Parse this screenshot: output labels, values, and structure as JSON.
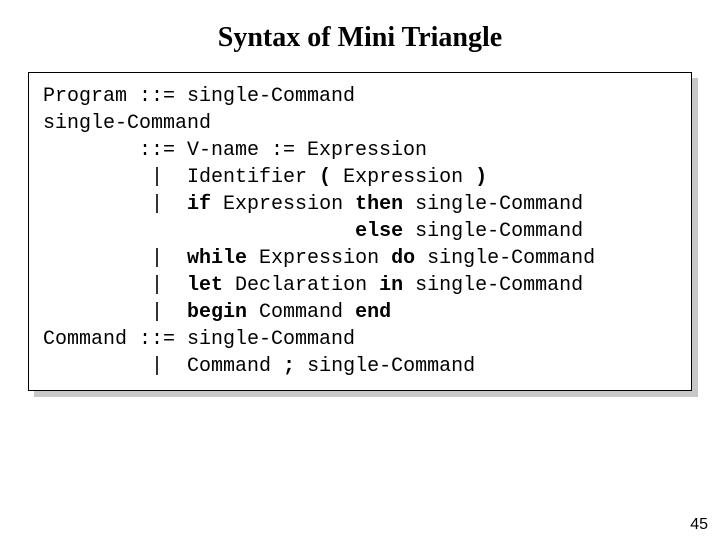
{
  "title": "Syntax of Mini Triangle",
  "page_number": "45",
  "grammar": {
    "l1a": "Program ::= single-Command",
    "l2a": "single-Command",
    "l3a": "        ::= V-name := Expression",
    "l4a": "         |  Identifier ",
    "l4b": "(",
    "l4c": " Expression ",
    "l4d": ")",
    "l5a": "         |  ",
    "l5b": "if",
    "l5c": " Expression ",
    "l5d": "then",
    "l5e": " single-Command",
    "l6a": "                          ",
    "l6b": "else",
    "l6c": " single-Command",
    "l7a": "         |  ",
    "l7b": "while",
    "l7c": " Expression ",
    "l7d": "do",
    "l7e": " single-Command",
    "l8a": "         |  ",
    "l8b": "let",
    "l8c": " Declaration ",
    "l8d": "in",
    "l8e": " single-Command",
    "l9a": "         |  ",
    "l9b": "begin",
    "l9c": " Command ",
    "l9d": "end",
    "l10a": "Command ::= single-Command",
    "l11a": "         |  Command ",
    "l11b": ";",
    "l11c": " single-Command"
  }
}
